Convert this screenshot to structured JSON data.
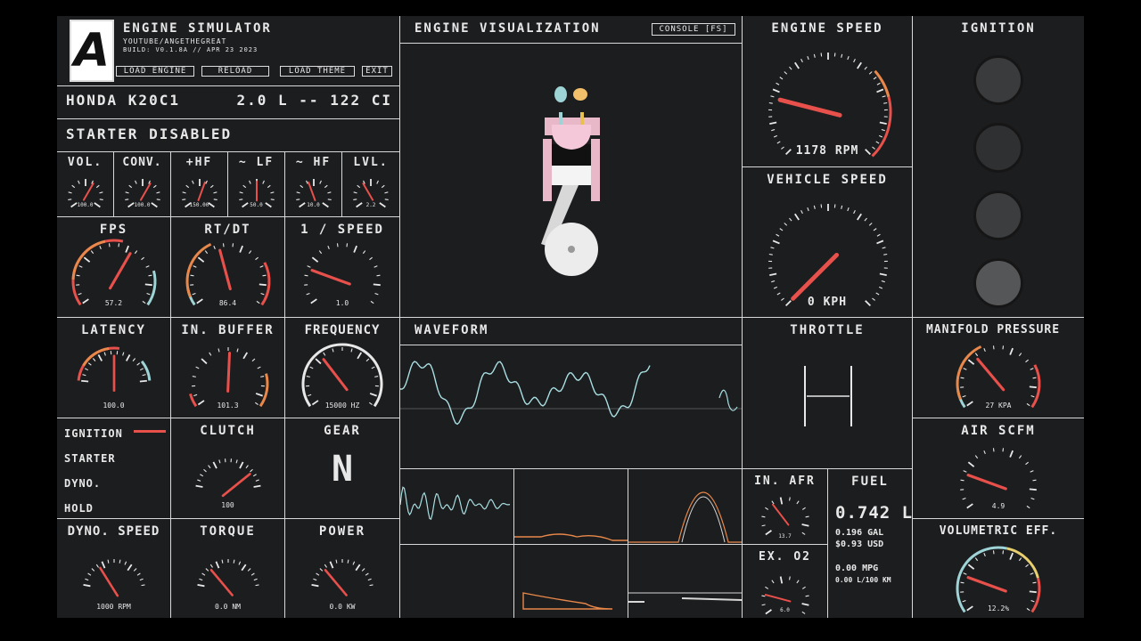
{
  "header": {
    "logo": "A",
    "title": "ENGINE SIMULATOR",
    "channel": "YOUTUBE/ANGETHEGREAT",
    "build": "BUILD: V0.1.8A // APR 23 2023",
    "buttons": [
      "LOAD ENGINE",
      "RELOAD",
      "LOAD THEME",
      "EXIT"
    ]
  },
  "engine": {
    "name": "HONDA K20C1",
    "displacement": "2.0 L -- 122 CI",
    "starter_status": "STARTER DISABLED"
  },
  "visualization": {
    "title": "ENGINE VISUALIZATION",
    "console_button": "CONSOLE [FS]"
  },
  "waveform": {
    "title": "WAVEFORM"
  },
  "small_gauges": [
    {
      "label": "VOL.",
      "value": "100.0"
    },
    {
      "label": "CONV.",
      "value": "100.0"
    },
    {
      "label": "+HF",
      "value": "150.00"
    },
    {
      "label": "~ LF",
      "value": "50.0"
    },
    {
      "label": "~ HF",
      "value": "10.0"
    },
    {
      "label": "LVL.",
      "value": "2.2"
    }
  ],
  "gauges": {
    "engine_speed": {
      "title": "ENGINE SPEED",
      "value": "1178 RPM"
    },
    "vehicle_speed": {
      "title": "VEHICLE SPEED",
      "value": "0 KPH"
    },
    "fps": {
      "title": "FPS",
      "value": "57.2"
    },
    "rt_dt": {
      "title": "RT/DT",
      "value": "86.4"
    },
    "inv_speed": {
      "title": "1 / SPEED",
      "value": "1.0"
    },
    "latency": {
      "title": "LATENCY",
      "value": "100.0"
    },
    "in_buffer": {
      "title": "IN. BUFFER",
      "value": "101.3"
    },
    "frequency": {
      "title": "FREQUENCY",
      "value": "15000 HZ"
    },
    "clutch": {
      "title": "CLUTCH",
      "value": "100"
    },
    "dyno_speed": {
      "title": "DYNO. SPEED",
      "value": "1000 RPM"
    },
    "torque": {
      "title": "TORQUE",
      "value": "0.0 NM"
    },
    "power": {
      "title": "POWER",
      "value": "0.0 KW"
    },
    "manifold_pressure": {
      "title": "MANIFOLD PRESSURE",
      "value": "27 KPA"
    },
    "air_scfm": {
      "title": "AIR SCFM",
      "value": "4.9"
    },
    "in_afr": {
      "title": "IN. AFR",
      "value": "13.7"
    },
    "ex_o2": {
      "title": "EX. O2",
      "value": "6.0"
    },
    "volumetric_eff": {
      "title": "VOLUMETRIC EFF.",
      "value": "12.2%"
    }
  },
  "ignition": {
    "title": "IGNITION"
  },
  "throttle": {
    "title": "THROTTLE"
  },
  "gear": {
    "title": "GEAR",
    "value": "N"
  },
  "switches": [
    {
      "label": "IGNITION",
      "on": true
    },
    {
      "label": "STARTER",
      "on": false
    },
    {
      "label": "DYNO.",
      "on": false
    },
    {
      "label": "HOLD",
      "on": false
    }
  ],
  "fuel": {
    "title": "FUEL",
    "liters": "0.742",
    "unit": "L",
    "gallons": "0.196 GAL",
    "cost": "$0.93 USD",
    "mpg": "0.00 MPG",
    "l_per_100km": "0.00 L/100 KM"
  },
  "colors": {
    "accent_red": "#e8504b",
    "accent_orange": "#e8884a",
    "accent_cyan": "#9fd4d6",
    "grid": "#d8d8d8",
    "panel": "#1c1d1f"
  }
}
